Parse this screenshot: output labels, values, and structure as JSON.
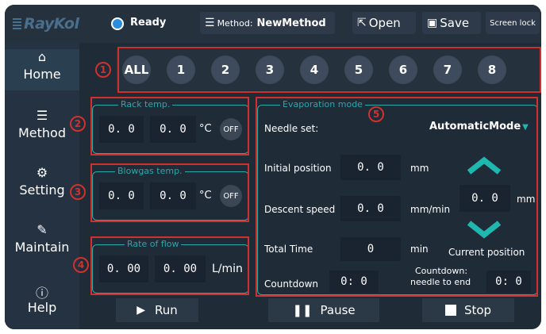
{
  "header": {
    "logo": "RayKol",
    "status": "Ready",
    "method_label": "Method:",
    "method_name": "NewMethod",
    "open_label": "Open",
    "save_label": "Save",
    "screenlock_label": "Screen lock"
  },
  "sidebar": {
    "items": [
      {
        "label": "Home",
        "icon": "home-icon"
      },
      {
        "label": "Method",
        "icon": "list-icon"
      },
      {
        "label": "Setting",
        "icon": "gear-icon"
      },
      {
        "label": "Maintain",
        "icon": "wrench-icon"
      },
      {
        "label": "Help",
        "icon": "help-icon"
      }
    ]
  },
  "channels": [
    "ALL",
    "1",
    "2",
    "3",
    "4",
    "5",
    "6",
    "7",
    "8"
  ],
  "rack_temp": {
    "legend": "Rack temp.",
    "value1": "0. 0",
    "value2": "0. 0",
    "unit": "°C",
    "toggle": "OFF"
  },
  "blowgas_temp": {
    "legend": "Blowgas temp.",
    "value1": "0. 0",
    "value2": "0. 0",
    "unit": "°C",
    "toggle": "OFF"
  },
  "rate_of_flow": {
    "legend": "Rate of flow",
    "value1": "0. 00",
    "value2": "0. 00",
    "unit": "L/min"
  },
  "evaporation": {
    "legend": "Evaporation mode",
    "needle_set_label": "Needle set:",
    "needle_mode": "AutomaticMode",
    "initial_position_label": "Initial position",
    "initial_position_value": "0. 0",
    "initial_position_unit": "mm",
    "descent_speed_label": "Descent speed",
    "descent_speed_value": "0. 0",
    "descent_speed_unit": "mm/min",
    "total_time_label": "Total Time",
    "total_time_value": "0",
    "total_time_unit": "min",
    "countdown_label": "Countdown",
    "countdown_value": "0: 0",
    "current_position_value": "0. 0",
    "current_position_unit": "mm",
    "current_position_label": "Current position",
    "countdown_needle_label_1": "Countdown:",
    "countdown_needle_label_2": "needle to end",
    "countdown_needle_value": "0: 0"
  },
  "annotations": [
    "1",
    "2",
    "3",
    "4",
    "5"
  ],
  "bottom": {
    "run": "Run",
    "pause": "Pause",
    "stop": "Stop"
  },
  "colors": {
    "accent_teal": "#2aa8a8",
    "annotation_red": "#d0312d",
    "status_blue": "#2a8ee0",
    "arrow_teal": "#1fb8b0"
  }
}
